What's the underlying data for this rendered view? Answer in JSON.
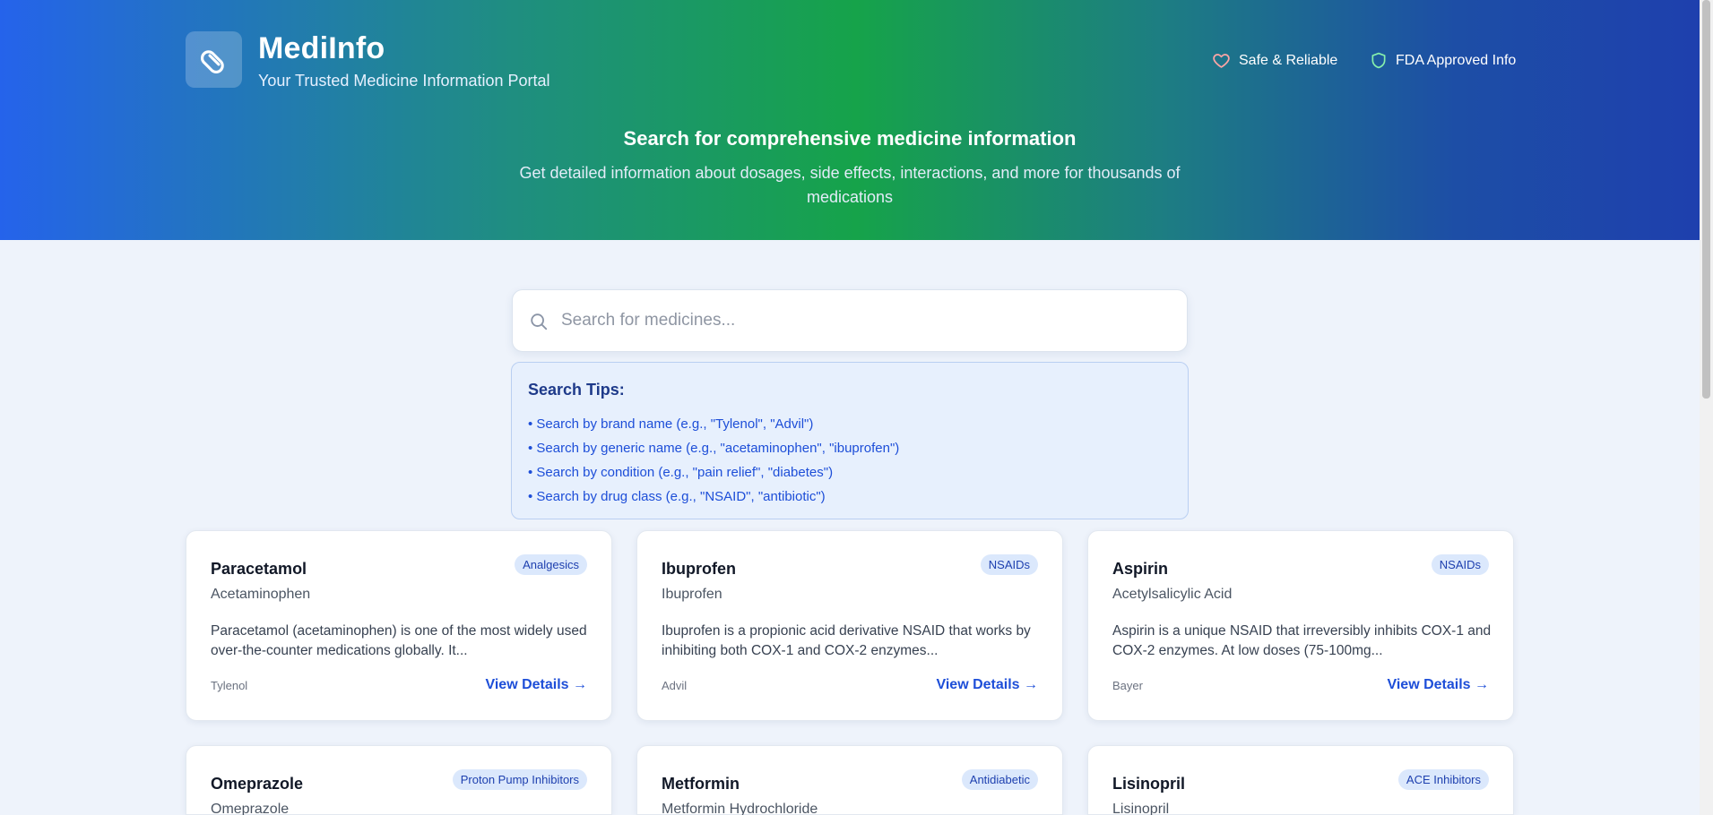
{
  "header": {
    "brand_title": "MediInfo",
    "brand_subtitle": "Your Trusted Medicine Information Portal",
    "logo_icon": "pill-icon",
    "badges": [
      {
        "icon": "heart-icon",
        "label": "Safe & Reliable",
        "color": "#fca5a5"
      },
      {
        "icon": "shield-icon",
        "label": "FDA Approved Info",
        "color": "#86efac"
      }
    ],
    "hero_title": "Search for comprehensive medicine information",
    "hero_description": "Get detailed information about dosages, side effects, interactions, and more for thousands of medications"
  },
  "search": {
    "placeholder": "Search for medicines...",
    "value": "",
    "icon": "search-icon"
  },
  "tips": {
    "title": "Search Tips:",
    "items": [
      "• Search by brand name (e.g., \"Tylenol\", \"Advil\")",
      "• Search by generic name (e.g., \"acetaminophen\", \"ibuprofen\")",
      "• Search by condition (e.g., \"pain relief\", \"diabetes\")",
      "• Search by drug class (e.g., \"NSAID\", \"antibiotic\")"
    ]
  },
  "medicines": [
    {
      "name": "Paracetamol",
      "generic": "Acetaminophen",
      "category": "Analgesics",
      "description": "Paracetamol (acetaminophen) is one of the most widely used over-the-counter medications globally. It...",
      "brand": "Tylenol",
      "link": "View Details →"
    },
    {
      "name": "Ibuprofen",
      "generic": "Ibuprofen",
      "category": "NSAIDs",
      "description": "Ibuprofen is a propionic acid derivative NSAID that works by inhibiting both COX-1 and COX-2 enzymes...",
      "brand": "Advil",
      "link": "View Details →"
    },
    {
      "name": "Aspirin",
      "generic": "Acetylsalicylic Acid",
      "category": "NSAIDs",
      "description": "Aspirin is a unique NSAID that irreversibly inhibits COX-1 and COX-2 enzymes. At low doses (75-100mg...",
      "brand": "Bayer",
      "link": "View Details →"
    },
    {
      "name": "Omeprazole",
      "generic": "Omeprazole",
      "category": "Proton Pump Inhibitors",
      "description": "",
      "brand": "",
      "link": ""
    },
    {
      "name": "Metformin",
      "generic": "Metformin Hydrochloride",
      "category": "Antidiabetic",
      "description": "",
      "brand": "",
      "link": ""
    },
    {
      "name": "Lisinopril",
      "generic": "Lisinopril",
      "category": "ACE Inhibitors",
      "description": "",
      "brand": "",
      "link": ""
    }
  ],
  "colors": {
    "accent": "#1d4ed8",
    "header_gradient_start": "#2563eb",
    "header_gradient_mid": "#16a34a",
    "header_gradient_end": "#1e3fae"
  }
}
